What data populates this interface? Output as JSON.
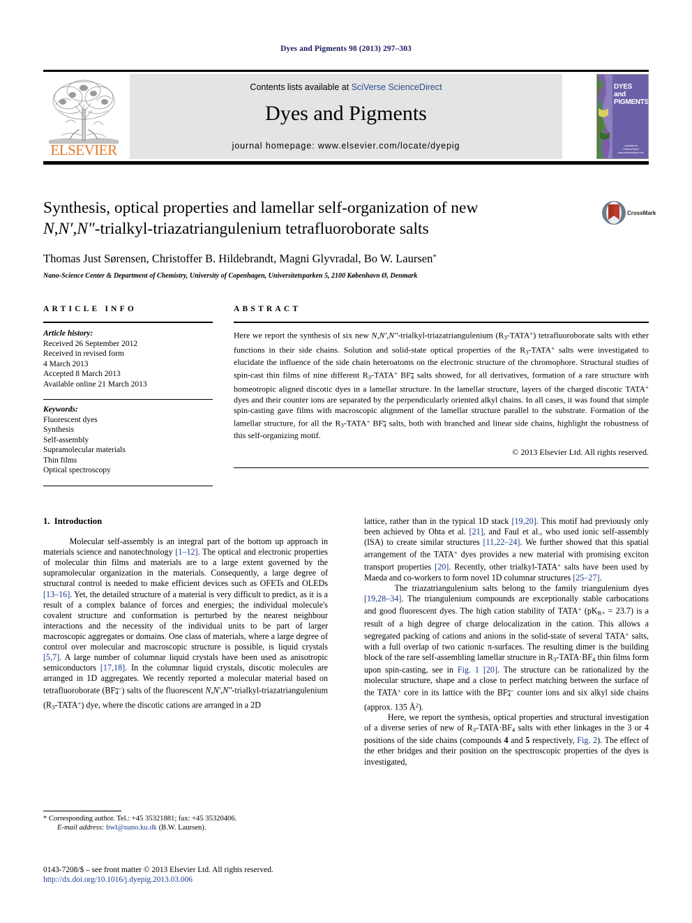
{
  "running_head": "Dyes and Pigments 98 (2013) 297–303",
  "masthead": {
    "contents_prefix": "Contents lists available at ",
    "contents_link": "SciVerse ScienceDirect",
    "journal_title": "Dyes and Pigments",
    "homepage": "journal homepage: www.elsevier.com/locate/dyepig",
    "publisher_name": "ELSEVIER",
    "cover_title_lines": [
      "DYES",
      "and",
      "PIGMENTS"
    ],
    "cover_footer": "available at\nScienceDirect\nwww.sciencedirect.com"
  },
  "title": {
    "line1": "Synthesis, optical properties and lamellar self-organization of new",
    "line2_italic": "N,N′,N″",
    "line2_rest": "-trialkyl-triazatriangulenium tetrafluoroborate salts",
    "crossmark_label": "CrossMark"
  },
  "authors": "Thomas Just Sørensen, Christoffer B. Hildebrandt, Magni Glyvradal, Bo W. Laursen",
  "author_star": "*",
  "affiliation": "Nano-Science Center & Department of Chemistry, University of Copenhagen, Universitetsparken 5, 2100 København Ø, Denmark",
  "article_info": {
    "heading": "ARTICLE INFO",
    "history_label": "Article history:",
    "history": [
      "Received 26 September 2012",
      "Received in revised form",
      "4 March 2013",
      "Accepted 8 March 2013",
      "Available online 21 March 2013"
    ],
    "keywords_label": "Keywords:",
    "keywords": [
      "Fluorescent dyes",
      "Synthesis",
      "Self-assembly",
      "Supramolecular materials",
      "Thin films",
      "Optical spectroscopy"
    ]
  },
  "abstract": {
    "heading": "ABSTRACT",
    "p1_a": "Here we report the synthesis of six new ",
    "p1_ital": "N,N′,N″",
    "p1_b": "-trialkyl-triazatriangulenium (R",
    "p1_sub1": "3",
    "p1_c": "-TATA",
    "p1_sup1": "+",
    "p1_d": ") tetrafluoroborate salts with ether functions in their side chains. Solution and solid-state optical properties of the R",
    "p1_e": "-TATA",
    "p1_f": " salts were investigated to elucidate the influence of the side chain heteroatoms on the electronic structure of the chromophore. Structural studies of spin-cast thin films of nine different R",
    "p1_g": "-TATA",
    "p1_bf4": "BF",
    "p1_bf4sub": "4",
    "p1_h": " salts showed, for all derivatives, formation of a rare structure with homeotropic aligned discotic dyes in a lamellar structure. In the lamellar structure, layers of the charged discotic TATA",
    "p1_i": " dyes and their counter ions are separated by the perpendicularly oriented alkyl chains. In all cases, it was found that simple spin-casting gave films with macroscopic alignment of the lamellar structure parallel to the substrate. Formation of the lamellar structure, for all the R",
    "p1_j": "-TATA",
    "p1_k": " salts, both with branched and linear side chains, highlight the robustness of this self-organizing motif.",
    "copyright": "© 2013 Elsevier Ltd. All rights reserved."
  },
  "body": {
    "section_number": "1.",
    "section_title": "Introduction",
    "left_paragraphs": [
      "Molecular self-assembly is an integral part of the bottom up approach in materials science and nanotechnology [1–12]. The optical and electronic properties of molecular thin films and materials are to a large extent governed by the supramolecular organization in the materials. Consequently, a large degree of structural control is needed to make efficient devices such as OFETs and OLEDs [13–16]. Yet, the detailed structure of a material is very difficult to predict, as it is a result of a complex balance of forces and energies; the individual molecule's covalent structure and conformation is perturbed by the nearest neighbour interactions and the necessity of the individual units to be part of larger macroscopic aggregates or domains. One class of materials, where a large degree of control over molecular and macroscopic structure is possible, is liquid crystals [5,7]. A large number of columnar liquid crystals have been used as anisotropic semiconductors [17,18]. In the columnar liquid crystals, discotic molecules are arranged in 1D aggregates. We recently reported a molecular material based on tetrafluoroborate (BF4−) salts of the fluorescent N,N′,N″-trialkyl-triazatriangulenium (R3-TATA+) dye, where the discotic cations are arranged in a 2D"
    ],
    "right_paragraphs": [
      "lattice, rather than in the typical 1D stack [19,20]. This motif had previously only been achieved by Ohta et al. [21], and Faul et al., who used ionic self-assembly (ISA) to create similar structures [11,22–24]. We further showed that this spatial arrangement of the TATA+ dyes provides a new material with promising exciton transport properties [20]. Recently, other trialkyl-TATA+ salts have been used by Maeda and co-workers to form novel 1D columnar structures [25–27].",
      "The triazatriangulenium salts belong to the family triangulenium dyes [19,28–34]. The triangulenium compounds are exceptionally stable carbocations and good fluorescent dyes. The high cation stability of TATA+ (pKR+ = 23.7) is a result of a high degree of charge delocalization in the cation. This allows a segregated packing of cations and anions in the solid-state of several TATA+ salts, with a full overlap of two cationic π-surfaces. The resulting dimer is the building block of the rare self-assembling lamellar structure in R3-TATA·BF4 thin films form upon spin-casting, see in Fig. 1 [20]. The structure can be rationalized by the molecular structure, shape and a close to perfect matching between the surface of the TATA+ core in its lattice with the BF4− counter ions and six alkyl side chains (approx. 135 Å2).",
      "Here, we report the synthesis, optical properties and structural investigation of a diverse series of new of R3-TATA·BF4 salts with ether linkages in the 3 or 4 positions of the side chains (compounds 4 and 5 respectively, Fig. 2). The effect of the ether bridges and their position on the spectroscopic properties of the dyes is investigated,"
    ]
  },
  "footnote": {
    "star": "*",
    "corresponding": " Corresponding author. Tel.: +45 35321881; fax: +45 35320406.",
    "email_label": "E-mail address:",
    "email": "bwl@nano.ku.dk",
    "email_suffix": " (B.W. Laursen)."
  },
  "footer": {
    "issn_line": "0143-7208/$ – see front matter © 2013 Elsevier Ltd. All rights reserved.",
    "doi_line": "http://dx.doi.org/10.1016/j.dyepig.2013.03.006"
  },
  "colors": {
    "link_blue": "#1a3a8f",
    "running_head_blue": "#1a1a60",
    "elsevier_orange": "#e87722",
    "masthead_gray": "#e4e4e4",
    "cover_purple": "#6b5fa8"
  }
}
